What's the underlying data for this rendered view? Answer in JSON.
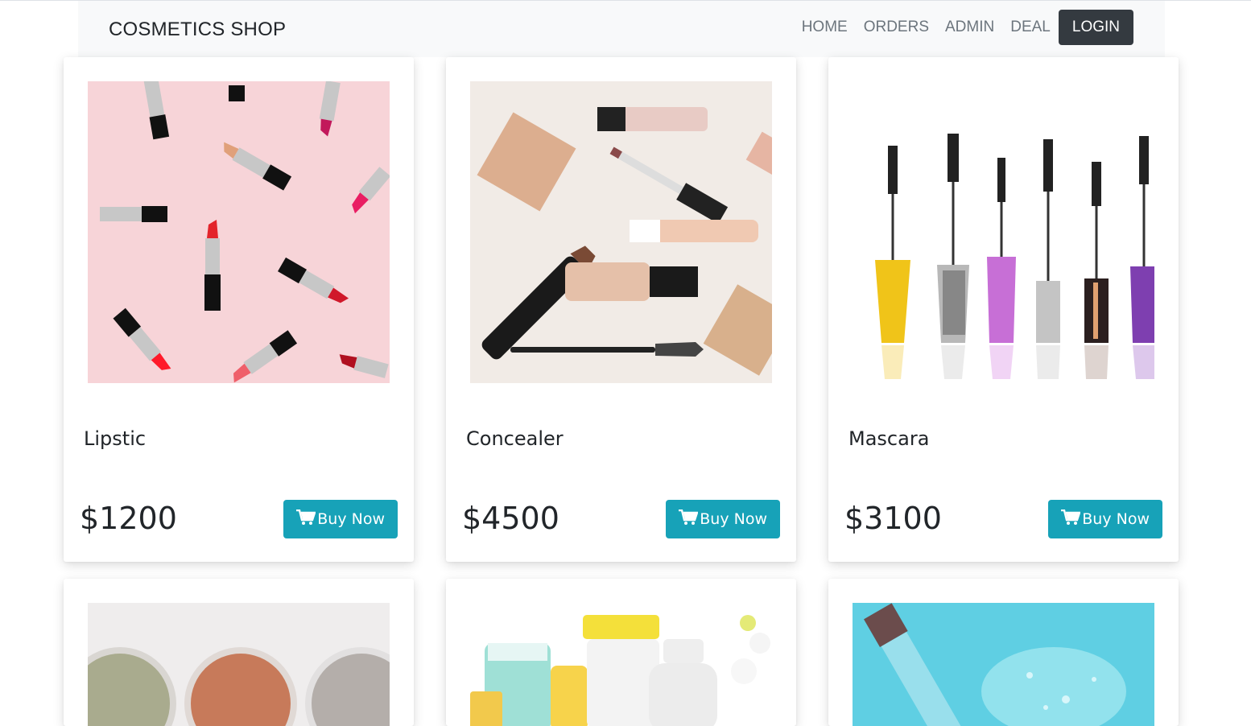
{
  "navbar": {
    "brand": "COSMETICS SHOP",
    "links": [
      "HOME",
      "ORDERS",
      "ADMIN",
      "DEAL"
    ],
    "login_label": "LOGIN"
  },
  "products": [
    {
      "name": "Lipstic",
      "price": "$1200",
      "button": "Buy Now",
      "image": "lipsticks-image"
    },
    {
      "name": "Concealer",
      "price": "$4500",
      "button": "Buy Now",
      "image": "concealer-image"
    },
    {
      "name": "Mascara",
      "price": "$3100",
      "button": "Buy Now",
      "image": "mascara-image"
    },
    {
      "image": "powder-image"
    },
    {
      "image": "skincare-bottles-image"
    },
    {
      "image": "serum-dropper-image"
    }
  ],
  "colors": {
    "navbar_bg": "#f8f9fa",
    "login_bg": "#343a40",
    "buy_button": "#17a2b8",
    "text": "#212529",
    "nav_link": "#6c757d"
  },
  "icons": {
    "buy_button": "cart-icon"
  }
}
